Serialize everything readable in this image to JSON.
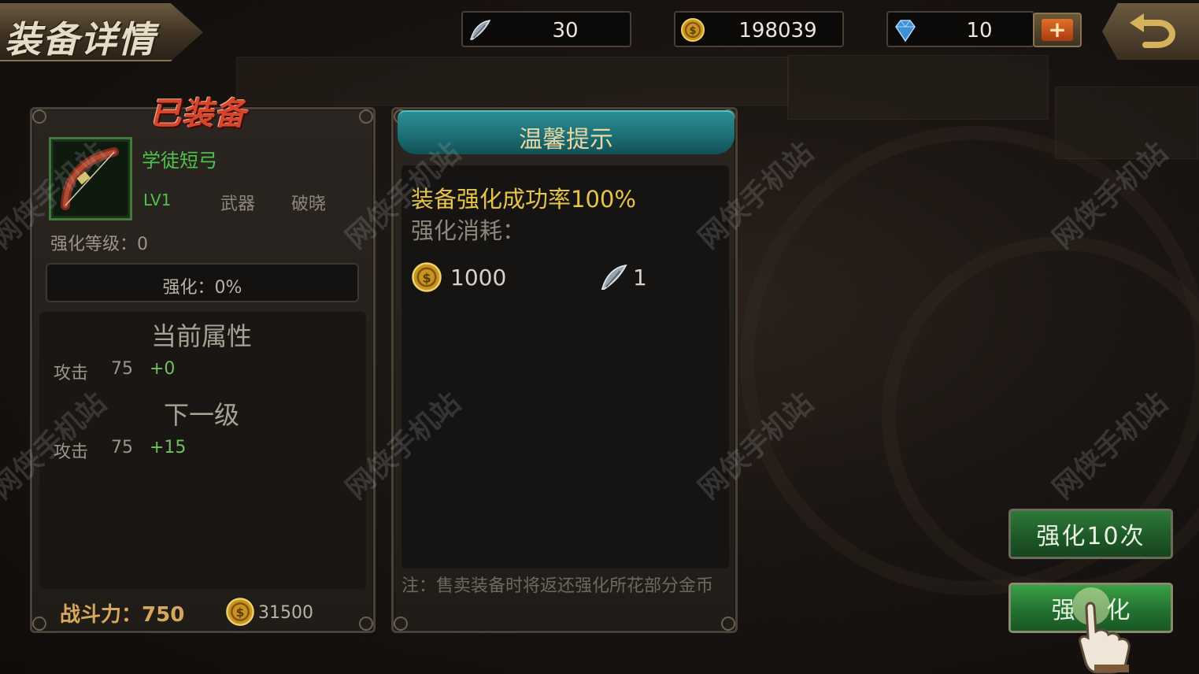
{
  "header": {
    "title": "装备详情",
    "resources": {
      "feather": "30",
      "gold": "198039",
      "diamond": "10"
    },
    "plus_label": "+"
  },
  "left_panel": {
    "status_tag": "已装备",
    "item_name": "学徒短弓",
    "level": "LV1",
    "item_type": "武器",
    "item_set": "破晓",
    "enhance_level_label": "强化等级：",
    "enhance_level_value": "0",
    "progress_label": "强化：",
    "progress_value": "0%",
    "progress_fraction": 0,
    "current_attr_title": "当前属性",
    "current_attr": {
      "name": "攻击",
      "value": "75",
      "bonus": "+0"
    },
    "next_level_title": "下一级",
    "next_attr": {
      "name": "攻击",
      "value": "75",
      "bonus": "+15"
    },
    "power_label": "战斗力：",
    "power_value": "750",
    "sell_price": "31500"
  },
  "right_panel": {
    "header": "温馨提示",
    "success_rate": "装备强化成功率100%",
    "cost_label": "强化消耗：",
    "cost_gold": "1000",
    "cost_feather": "1",
    "note": "注：售卖装备时将返还强化所花部分金币"
  },
  "buttons": {
    "enhance_10": "强化10次",
    "enhance": "强化"
  },
  "watermark": "网侠手机站",
  "colors": {
    "item_name": "#4fc24a",
    "bonus": "#6fc25a",
    "gold_text": "#e6c44a",
    "teal_header": "#1b6d73"
  }
}
